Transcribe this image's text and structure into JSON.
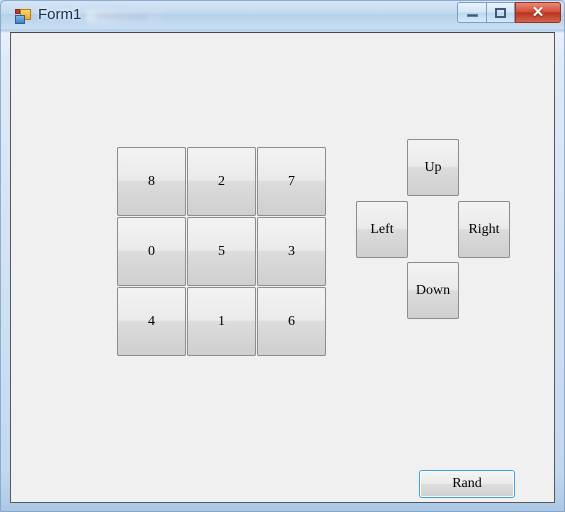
{
  "window": {
    "title": "Form1",
    "icon": "winforms-app-icon",
    "frame_color": "#c3d9ef",
    "client_bg": "#f0f0f0",
    "controls": {
      "minimize": {
        "name": "minimize",
        "glyph": "—"
      },
      "maximize": {
        "name": "maximize",
        "glyph": "□"
      },
      "close": {
        "name": "close",
        "glyph": "✕",
        "color": "#b93520"
      }
    }
  },
  "puzzle": {
    "rows": [
      [
        {
          "label": "8"
        },
        {
          "label": "2"
        },
        {
          "label": "7"
        }
      ],
      [
        {
          "label": "0"
        },
        {
          "label": "5"
        },
        {
          "label": "3"
        }
      ],
      [
        {
          "label": "4"
        },
        {
          "label": "1"
        },
        {
          "label": "6"
        }
      ]
    ]
  },
  "dpad": {
    "up": "Up",
    "left": "Left",
    "right": "Right",
    "down": "Down"
  },
  "actions": {
    "rand_label": "Rand",
    "rand_focus_color": "#3ca4dc"
  }
}
